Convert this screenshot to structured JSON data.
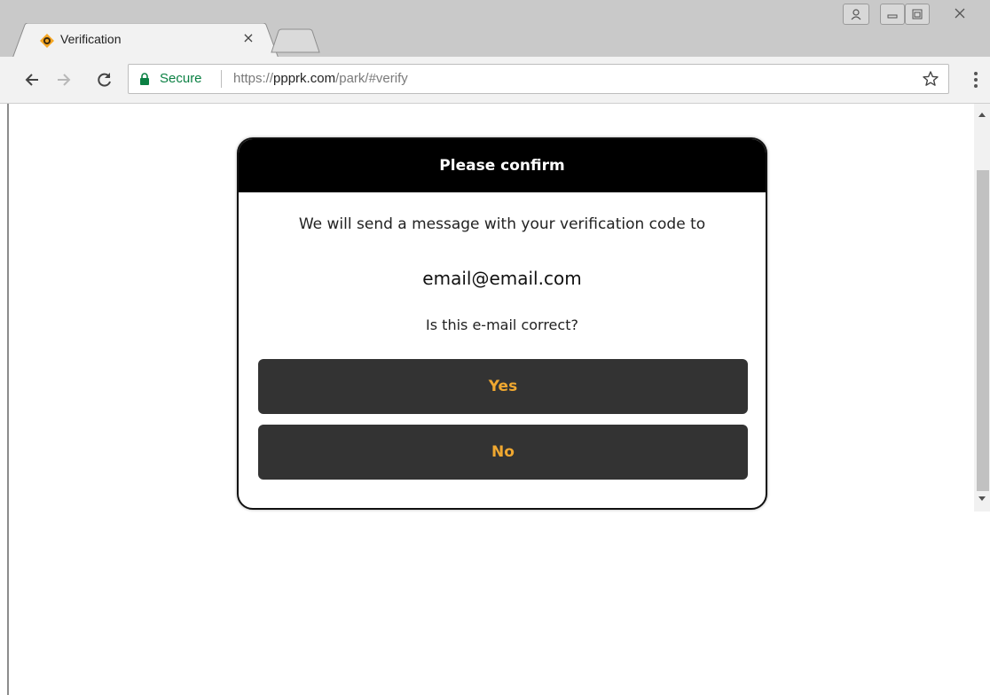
{
  "browser": {
    "tab_title": "Verification",
    "tab_close": "×",
    "secure_label": "Secure",
    "url_scheme": "https://",
    "url_host": "ppprk.com",
    "url_path": "/park/#verify",
    "icons": {
      "back": "back-arrow-icon",
      "forward": "forward-arrow-icon",
      "reload": "reload-icon",
      "lock": "lock-icon",
      "star": "star-icon",
      "menu": "menu-icon",
      "favicon": "ppprk-favicon-icon"
    },
    "colors": {
      "secure_green": "#0b8043",
      "favicon_orange": "#f5a623"
    }
  },
  "dialog": {
    "title": "Please confirm",
    "message": "We will send a message with your verification code to",
    "email": "email@email.com",
    "question": "Is this e-mail correct?",
    "yes_label": "Yes",
    "no_label": "No",
    "colors": {
      "header_bg": "#000000",
      "button_bg": "#333333",
      "button_text": "#f0a830"
    }
  }
}
